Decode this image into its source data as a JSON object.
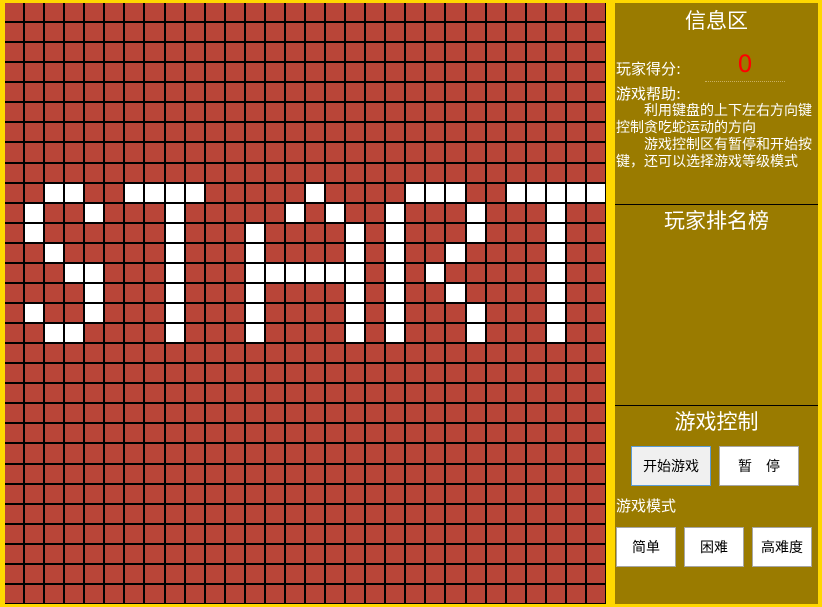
{
  "board": {
    "cols": 30,
    "rows": 30,
    "cell_color": "#b94538",
    "lit_color": "#ffffff",
    "grid_color": "#000000",
    "lit_cells": [
      [
        2,
        9
      ],
      [
        3,
        9
      ],
      [
        6,
        9
      ],
      [
        7,
        9
      ],
      [
        8,
        9
      ],
      [
        9,
        9
      ],
      [
        15,
        9
      ],
      [
        20,
        9
      ],
      [
        21,
        9
      ],
      [
        22,
        9
      ],
      [
        25,
        9
      ],
      [
        26,
        9
      ],
      [
        27,
        9
      ],
      [
        28,
        9
      ],
      [
        29,
        9
      ],
      [
        1,
        10
      ],
      [
        4,
        10
      ],
      [
        8,
        10
      ],
      [
        14,
        10
      ],
      [
        16,
        10
      ],
      [
        19,
        10
      ],
      [
        23,
        10
      ],
      [
        27,
        10
      ],
      [
        1,
        11
      ],
      [
        8,
        11
      ],
      [
        12,
        11
      ],
      [
        17,
        11
      ],
      [
        19,
        11
      ],
      [
        23,
        11
      ],
      [
        27,
        11
      ],
      [
        2,
        12
      ],
      [
        8,
        12
      ],
      [
        12,
        12
      ],
      [
        17,
        12
      ],
      [
        19,
        12
      ],
      [
        22,
        12
      ],
      [
        27,
        12
      ],
      [
        3,
        13
      ],
      [
        4,
        13
      ],
      [
        8,
        13
      ],
      [
        12,
        13
      ],
      [
        13,
        13
      ],
      [
        14,
        13
      ],
      [
        15,
        13
      ],
      [
        16,
        13
      ],
      [
        17,
        13
      ],
      [
        19,
        13
      ],
      [
        21,
        13
      ],
      [
        27,
        13
      ],
      [
        4,
        14
      ],
      [
        8,
        14
      ],
      [
        12,
        14
      ],
      [
        17,
        14
      ],
      [
        19,
        14
      ],
      [
        22,
        14
      ],
      [
        27,
        14
      ],
      [
        1,
        15
      ],
      [
        4,
        15
      ],
      [
        8,
        15
      ],
      [
        12,
        15
      ],
      [
        17,
        15
      ],
      [
        19,
        15
      ],
      [
        23,
        15
      ],
      [
        27,
        15
      ],
      [
        2,
        16
      ],
      [
        3,
        16
      ],
      [
        8,
        16
      ],
      [
        12,
        16
      ],
      [
        17,
        16
      ],
      [
        19,
        16
      ],
      [
        23,
        16
      ],
      [
        27,
        16
      ]
    ]
  },
  "info": {
    "title": "信息区",
    "score_label": "玩家得分:",
    "score": "0",
    "help_label": "游戏帮助:",
    "help_text_1": "　　利用键盘的上下左右方向键控制贪吃蛇运动的方向",
    "help_text_2": "　　游戏控制区有暂停和开始按键，还可以选择游戏等级模式"
  },
  "ranking": {
    "title": "玩家排名榜"
  },
  "control": {
    "title": "游戏控制",
    "start_label": "开始游戏",
    "pause_label": "暂　停",
    "mode_label": "游戏模式",
    "easy_label": "简单",
    "hard_label": "困难",
    "expert_label": "高难度"
  }
}
